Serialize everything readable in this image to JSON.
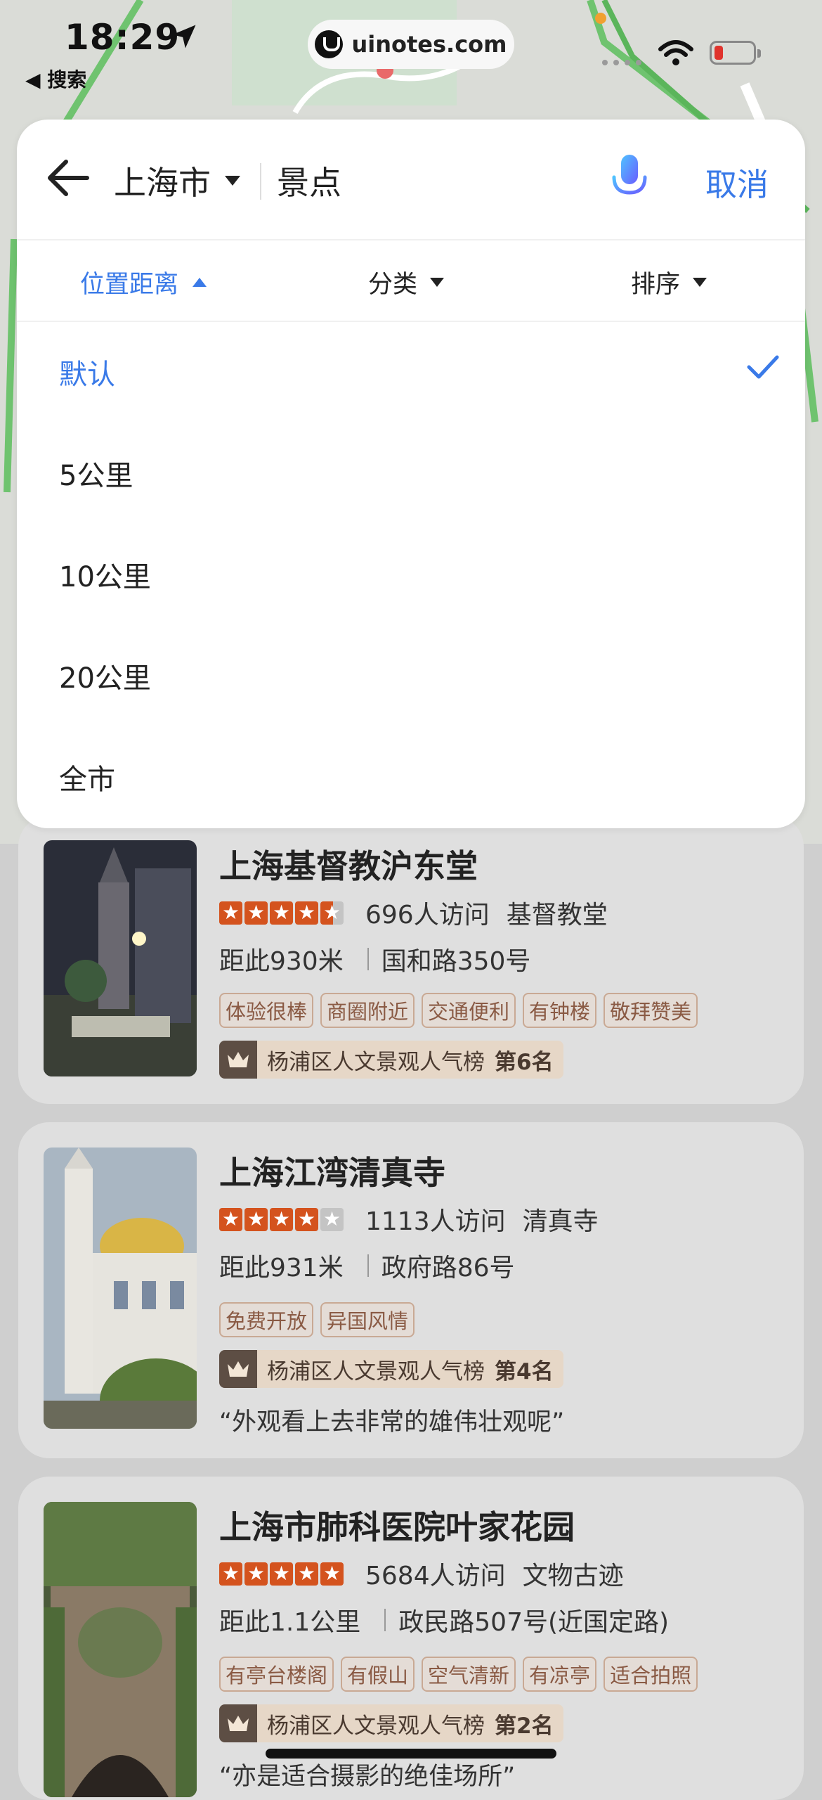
{
  "status_bar": {
    "time": "18:29",
    "back_app": "◀ 搜索",
    "url": "uinotes.com"
  },
  "search": {
    "city": "上海市",
    "keyword": "景点",
    "cancel_label": "取消"
  },
  "filters": {
    "distance": "位置距离",
    "category": "分类",
    "sort": "排序"
  },
  "distance_options": [
    {
      "label": "默认",
      "selected": true
    },
    {
      "label": "5公里",
      "selected": false
    },
    {
      "label": "10公里",
      "selected": false
    },
    {
      "label": "20公里",
      "selected": false
    },
    {
      "label": "全市",
      "selected": false
    }
  ],
  "results": [
    {
      "name": "上海基督教沪东堂",
      "rating": 4.5,
      "visits": "696人访问",
      "category": "基督教堂",
      "distance": "距此930米",
      "address": "国和路350号",
      "tags": [
        "体验很棒",
        "商圈附近",
        "交通便利",
        "有钟楼",
        "敬拜赞美"
      ],
      "rank_text": "杨浦区人文景观人气榜",
      "rank_num": "第6名",
      "quote": ""
    },
    {
      "name": "上海江湾清真寺",
      "rating": 4,
      "visits": "1113人访问",
      "category": "清真寺",
      "distance": "距此931米",
      "address": "政府路86号",
      "tags": [
        "免费开放",
        "异国风情"
      ],
      "rank_text": "杨浦区人文景观人气榜",
      "rank_num": "第4名",
      "quote": "“外观看上去非常的雄伟壮观呢”"
    },
    {
      "name": "上海市肺科医院叶家花园",
      "rating": 5,
      "visits": "5684人访问",
      "category": "文物古迹",
      "distance": "距此1.1公里",
      "address": "政民路507号(近国定路)",
      "tags": [
        "有亭台楼阁",
        "有假山",
        "空气清新",
        "有凉亭",
        "适合拍照"
      ],
      "rank_text": "杨浦区人文景观人气榜",
      "rank_num": "第2名",
      "quote": "“亦是适合摄影的绝佳场所”"
    }
  ],
  "colors": {
    "accent": "#3a7ae8",
    "star": "#d4531e",
    "tag_text": "#8a5a44"
  }
}
